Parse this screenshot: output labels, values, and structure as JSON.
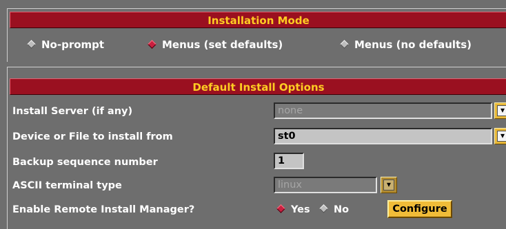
{
  "installation_mode": {
    "title": "Installation Mode",
    "options": [
      {
        "label": "No-prompt",
        "selected": false
      },
      {
        "label": "Menus (set defaults)",
        "selected": true
      },
      {
        "label": "Menus (no defaults)",
        "selected": false
      }
    ]
  },
  "default_options": {
    "title": "Default Install Options",
    "install_server": {
      "label": "Install Server (if any)",
      "value": "none",
      "enabled": false
    },
    "device": {
      "label": "Device or File to install from",
      "value": "st0",
      "enabled": true
    },
    "backup_seq": {
      "label": "Backup sequence number",
      "value": "1"
    },
    "terminal": {
      "label": "ASCII terminal type",
      "value": "linux",
      "enabled": false
    },
    "remote_manager": {
      "label": "Enable Remote Install Manager?",
      "yes_label": "Yes",
      "no_label": "No",
      "selected": "Yes",
      "configure_label": "Configure"
    }
  },
  "colors": {
    "title_bg": "#9a1020",
    "title_text": "#ffcc22",
    "panel_bg": "#6e6e6e",
    "accent_button": "#f0bc38"
  }
}
